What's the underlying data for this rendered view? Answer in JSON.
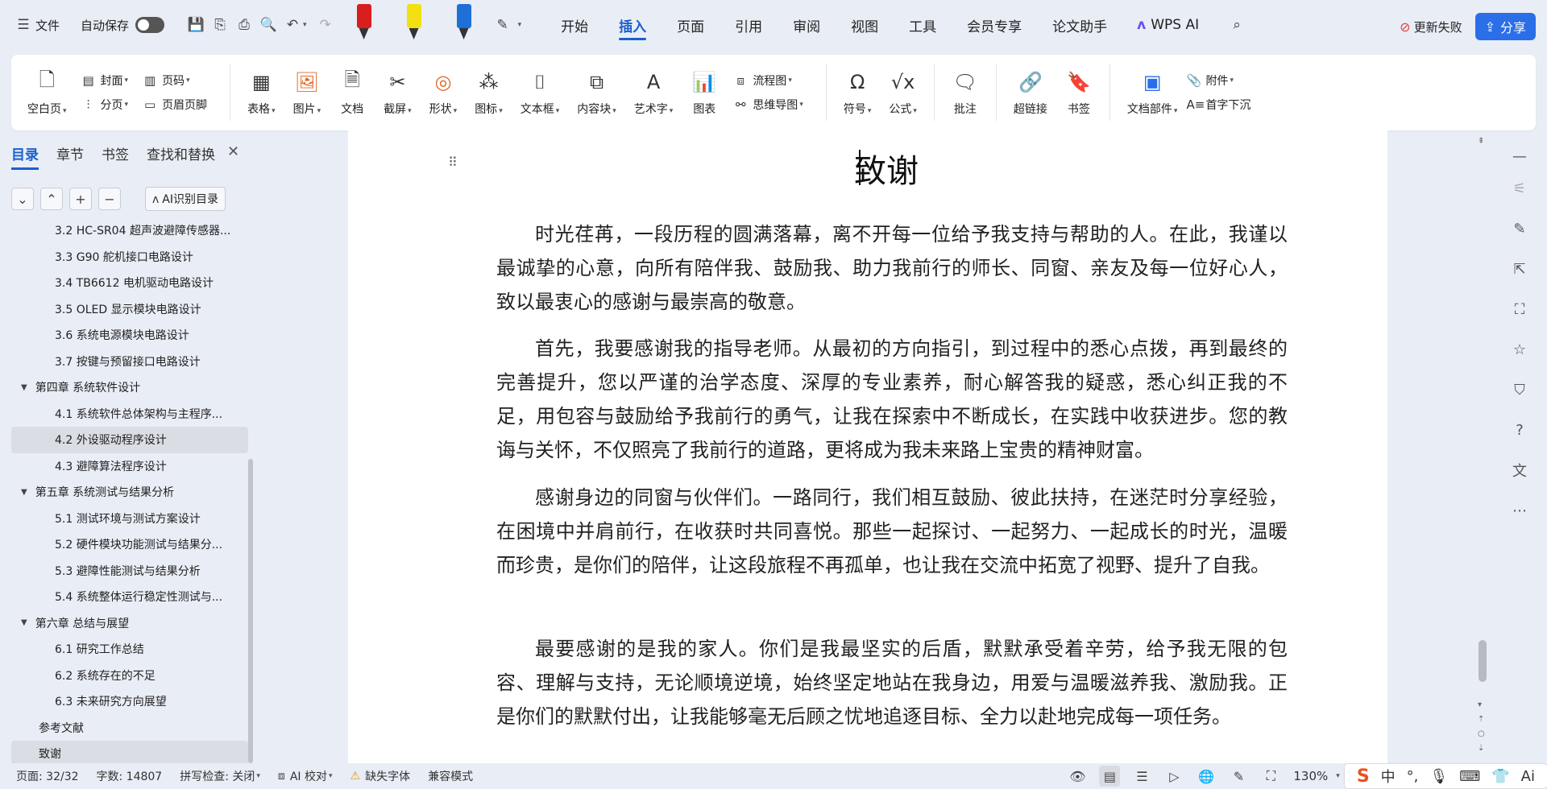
{
  "topbar": {
    "file_label": "文件",
    "autosave_label": "自动保存",
    "tabs": [
      "开始",
      "插入",
      "页面",
      "引用",
      "审阅",
      "视图",
      "工具",
      "会员专享",
      "论文助手"
    ],
    "active_tab": "插入",
    "wps_ai_label": "WPS AI",
    "update_fail_label": "更新失败",
    "share_label": "分享",
    "pen_colors": [
      "#d81e1e",
      "#f2e010",
      "#1e6fd8"
    ]
  },
  "ribbon": {
    "blank_page": "空白页",
    "cover": "封面",
    "page_break": "分页",
    "page_num": "页码",
    "header_footer": "页眉页脚",
    "table": "表格",
    "image": "图片",
    "document": "文档",
    "screenshot": "截屏",
    "shape": "形状",
    "icon": "图标",
    "textbox": "文本框",
    "content_block": "内容块",
    "art_text": "艺术字",
    "chart": "图表",
    "flowchart": "流程图",
    "mindmap": "思维导图",
    "symbol": "符号",
    "formula": "公式",
    "comment": "批注",
    "hyperlink": "超链接",
    "bookmark": "书签",
    "doc_parts": "文档部件",
    "attachment": "附件",
    "drop_cap": "首字下沉"
  },
  "left_panel": {
    "tabs": [
      "目录",
      "章节",
      "书签",
      "查找和替换"
    ],
    "active_tab": "目录",
    "ai_toc_label": "AI识别目录",
    "toc": [
      {
        "level": 2,
        "text": "3.2 HC-SR04 超声波避障传感器..."
      },
      {
        "level": 2,
        "text": "3.3 G90 舵机接口电路设计"
      },
      {
        "level": 2,
        "text": "3.4 TB6612 电机驱动电路设计"
      },
      {
        "level": 2,
        "text": "3.5 OLED 显示模块电路设计"
      },
      {
        "level": 2,
        "text": "3.6 系统电源模块电路设计"
      },
      {
        "level": 2,
        "text": "3.7 按键与预留接口电路设计"
      },
      {
        "level": 1,
        "text": "第四章  系统软件设计"
      },
      {
        "level": 2,
        "text": "4.1 系统软件总体架构与主程序..."
      },
      {
        "level": 2,
        "text": "4.2 外设驱动程序设计",
        "selected": true
      },
      {
        "level": 2,
        "text": "4.3 避障算法程序设计"
      },
      {
        "level": 1,
        "text": "第五章  系统测试与结果分析"
      },
      {
        "level": 2,
        "text": "5.1 测试环境与测试方案设计"
      },
      {
        "level": 2,
        "text": "5.2 硬件模块功能测试与结果分..."
      },
      {
        "level": 2,
        "text": "5.3 避障性能测试与结果分析"
      },
      {
        "level": 2,
        "text": "5.4 系统整体运行稳定性测试与..."
      },
      {
        "level": 1,
        "text": "第六章  总结与展望"
      },
      {
        "level": 2,
        "text": "6.1 研究工作总结"
      },
      {
        "level": 2,
        "text": "6.2 系统存在的不足"
      },
      {
        "level": 2,
        "text": "6.3 未来研究方向展望"
      },
      {
        "level": 0,
        "text": "参考文献"
      },
      {
        "level": 0,
        "text": "致谢",
        "selected": true
      }
    ]
  },
  "document": {
    "title": "致谢",
    "paragraphs": [
      "时光荏苒，一段历程的圆满落幕，离不开每一位给予我支持与帮助的人。在此，我谨以最诚挚的心意，向所有陪伴我、鼓励我、助力我前行的师长、同窗、亲友及每一位好心人，致以最衷心的感谢与最崇高的敬意。",
      "首先，我要感谢我的指导老师。从最初的方向指引，到过程中的悉心点拨，再到最终的完善提升，您以严谨的治学态度、深厚的专业素养，耐心解答我的疑惑，悉心纠正我的不足，用包容与鼓励给予我前行的勇气，让我在探索中不断成长，在实践中收获进步。您的教诲与关怀，不仅照亮了我前行的道路，更将成为我未来路上宝贵的精神财富。",
      "感谢身边的同窗与伙伴们。一路同行，我们相互鼓励、彼此扶持，在迷茫时分享经验，在困境中并肩前行，在收获时共同喜悦。那些一起探讨、一起努力、一起成长的时光，温暖而珍贵，是你们的陪伴，让这段旅程不再孤单，也让我在交流中拓宽了视野、提升了自我。",
      "最要感谢的是我的家人。你们是我最坚实的后盾，默默承受着辛劳，给予我无限的包容、理解与支持，无论顺境逆境，始终坚定地站在我身边，用爱与温暖滋养我、激励我。正是你们的默默付出，让我能够毫无后顾之忧地追逐目标、全力以赴地完成每一项任务。"
    ]
  },
  "statusbar": {
    "page": "页面: 32/32",
    "word_count": "字数: 14807",
    "spellcheck": "拼写检查: 关闭",
    "ai_proofread": "AI 校对",
    "missing_font": "缺失字体",
    "compat_mode": "兼容模式",
    "zoom": "130%",
    "ime_lang": "中"
  }
}
